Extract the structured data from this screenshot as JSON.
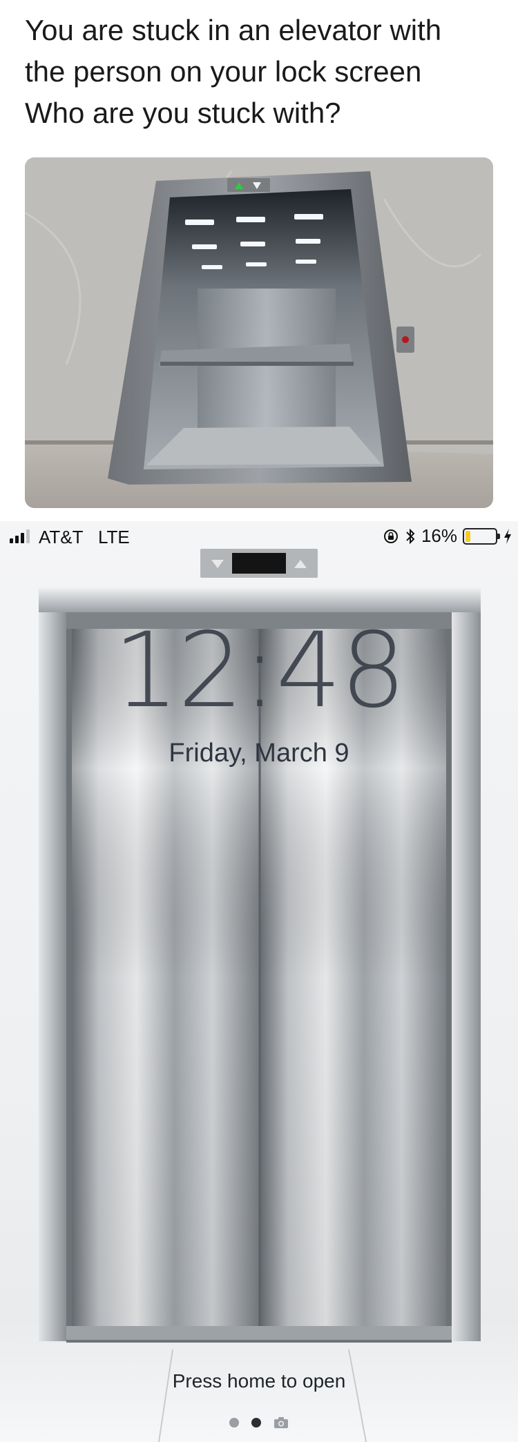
{
  "meme": {
    "caption_lines": [
      "You are stuck in an elevator with",
      "the person on your lock screen",
      "Who are you stuck with?"
    ]
  },
  "photo": {
    "subject": "open elevator cabin",
    "indicator_up_color": "#2ecc40"
  },
  "lock_screen": {
    "status_bar": {
      "carrier": "AT&T",
      "network": "LTE",
      "battery_percent": "16%",
      "battery_level": 0.16,
      "icons": [
        "signal-icon",
        "rotation-lock-icon",
        "bluetooth-icon",
        "battery-icon",
        "charging-bolt-icon"
      ]
    },
    "time": "12:48",
    "date": "Friday, March 9",
    "prompt": "Press home to open",
    "page_dots": {
      "count": 2,
      "active_index": 1,
      "trailing_icon": "camera-icon"
    },
    "wallpaper": "closed stainless steel elevator doors"
  }
}
